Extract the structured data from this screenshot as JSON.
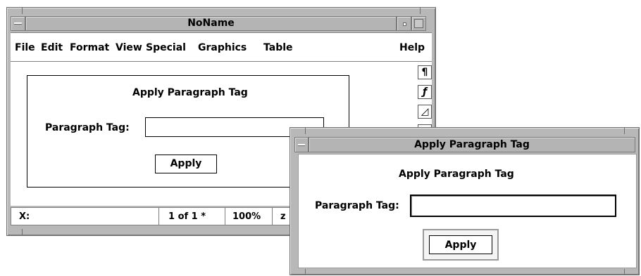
{
  "main_window": {
    "title": "NoName",
    "menu": {
      "file": "File",
      "edit": "Edit",
      "format": "Format",
      "view": "View",
      "special": "Special",
      "graphics": "Graphics",
      "table": "Table",
      "help": "Help"
    },
    "embedded_dialog": {
      "heading": "Apply Paragraph Tag",
      "field_label": "Paragraph Tag:",
      "field_value": "",
      "apply_label": "Apply"
    },
    "toolbar_icons": [
      {
        "name": "pilcrow-icon",
        "glyph": "¶"
      },
      {
        "name": "function-icon",
        "glyph": "ƒ"
      },
      {
        "name": "triangle-icon",
        "glyph": "◿"
      },
      {
        "name": "table-icon",
        "glyph": "▤"
      }
    ],
    "status": {
      "x_label": "X:",
      "page": "1 of 1 *",
      "zoom": "100%",
      "z": "z"
    }
  },
  "dialog_window": {
    "title": "Apply Paragraph Tag",
    "heading": "Apply Paragraph Tag",
    "field_label": "Paragraph Tag:",
    "field_value": "",
    "apply_label": "Apply"
  }
}
